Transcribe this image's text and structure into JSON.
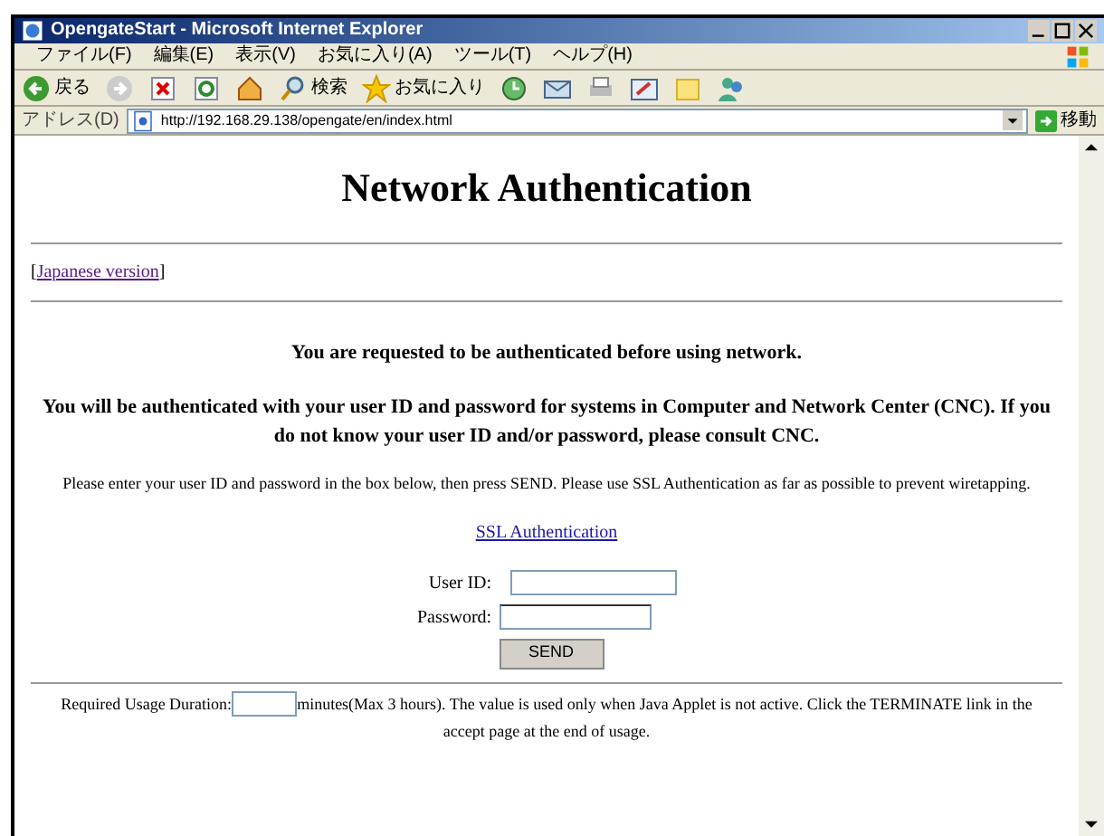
{
  "window": {
    "title": "OpengateStart - Microsoft Internet Explorer"
  },
  "menu": [
    "ファイル(F)",
    "編集(E)",
    "表示(V)",
    "お気に入り(A)",
    "ツール(T)",
    "ヘルプ(H)"
  ],
  "toolbar": {
    "back": "戻る",
    "search": "検索",
    "favorites": "お気に入り"
  },
  "address_bar": {
    "label": "アドレス(D)",
    "value": "http://192.168.29.138/opengate/en/index.html",
    "go": "移動"
  },
  "page": {
    "heading": "Network Authentication",
    "language_link": {
      "open": "[",
      "text": "Japanese version",
      "close": "]"
    },
    "notice": "You are requested to be authenticated before using network.",
    "explanation": "You will be authenticated with your user ID and password for systems in Computer and Network Center (CNC). If you do not know your user ID and/or password, please consult CNC.",
    "instruction": "Please enter your user ID and password in the box below, then press SEND. Please use SSL Authentication as far as possible to prevent wiretapping.",
    "ssl_link": "SSL Authentication",
    "form": {
      "user_id_label": "User ID:",
      "password_label": "Password:",
      "send": "SEND"
    },
    "duration": {
      "label": "Required Usage Duration:",
      "note": "minutes(Max 3 hours). The value is used only when Java Applet is not active. Click the TERMINATE link in the accept page at the end of usage."
    }
  }
}
